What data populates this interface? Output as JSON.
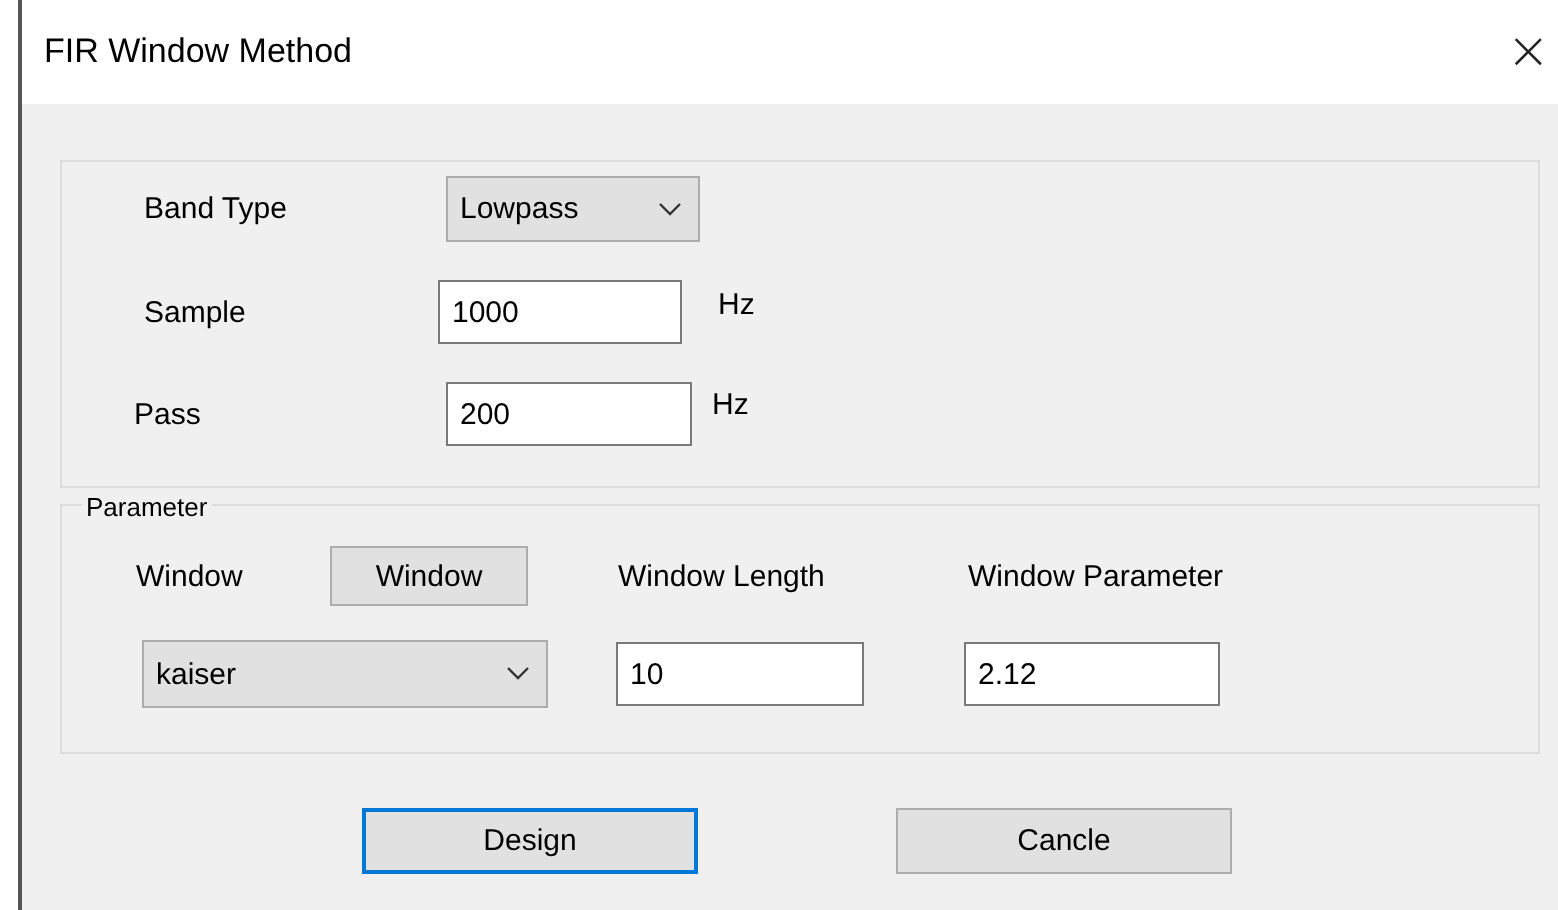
{
  "window": {
    "title": "FIR Window Method",
    "close": "×"
  },
  "filter": {
    "band_type": {
      "label": "Band Type",
      "value": "Lowpass"
    },
    "sample": {
      "label": "Sample",
      "value": "1000",
      "unit": "Hz"
    },
    "pass": {
      "label": "Pass",
      "value": "200",
      "unit": "Hz"
    }
  },
  "parameter": {
    "legend": "Parameter",
    "window_label": "Window",
    "window_button": "Window",
    "length_label": "Window Length",
    "parameter_label": "Window Parameter",
    "window_type": "kaiser",
    "length": "10",
    "window_parameter": "2.12"
  },
  "buttons": [
    {
      "label": "Design",
      "focused": true
    },
    {
      "label": "Cancle",
      "focused": false
    }
  ]
}
